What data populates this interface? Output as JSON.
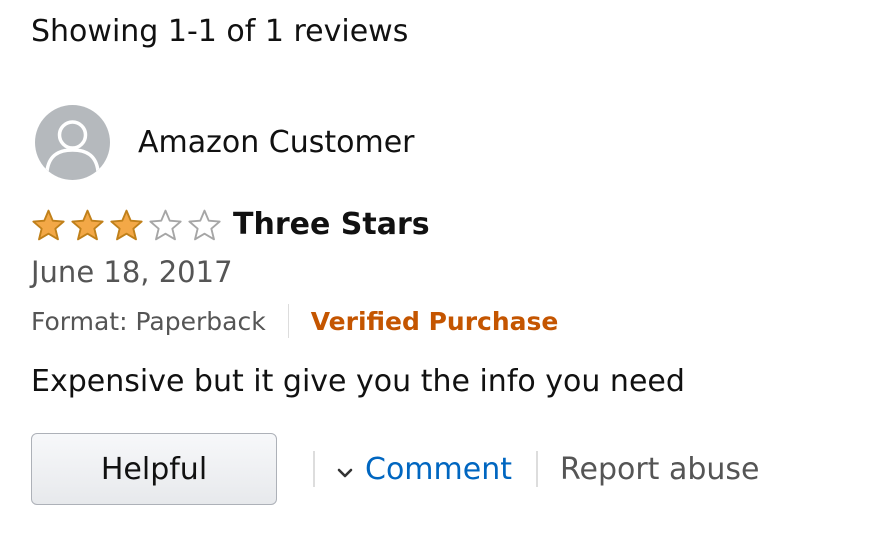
{
  "reviews_summary": "Showing 1-1 of 1 reviews",
  "review": {
    "author": {
      "name": "Amazon Customer",
      "avatar_icon": "default-user-avatar-icon"
    },
    "rating": 3,
    "rating_max": 5,
    "star_icon": "star-icon",
    "colors": {
      "star_fill": "#f3a847",
      "star_outline": "#c0801a",
      "verified": "#c45500",
      "link": "#0066c0"
    },
    "title": "Three Stars",
    "date": "June 18, 2017",
    "format": "Format: Paperback",
    "verified_label": "Verified Purchase",
    "body": "Expensive but it give you the info you need",
    "actions": {
      "helpful_label": "Helpful",
      "comment_label": "Comment",
      "comment_icon": "chevron-down-icon",
      "report_label": "Report abuse"
    }
  }
}
